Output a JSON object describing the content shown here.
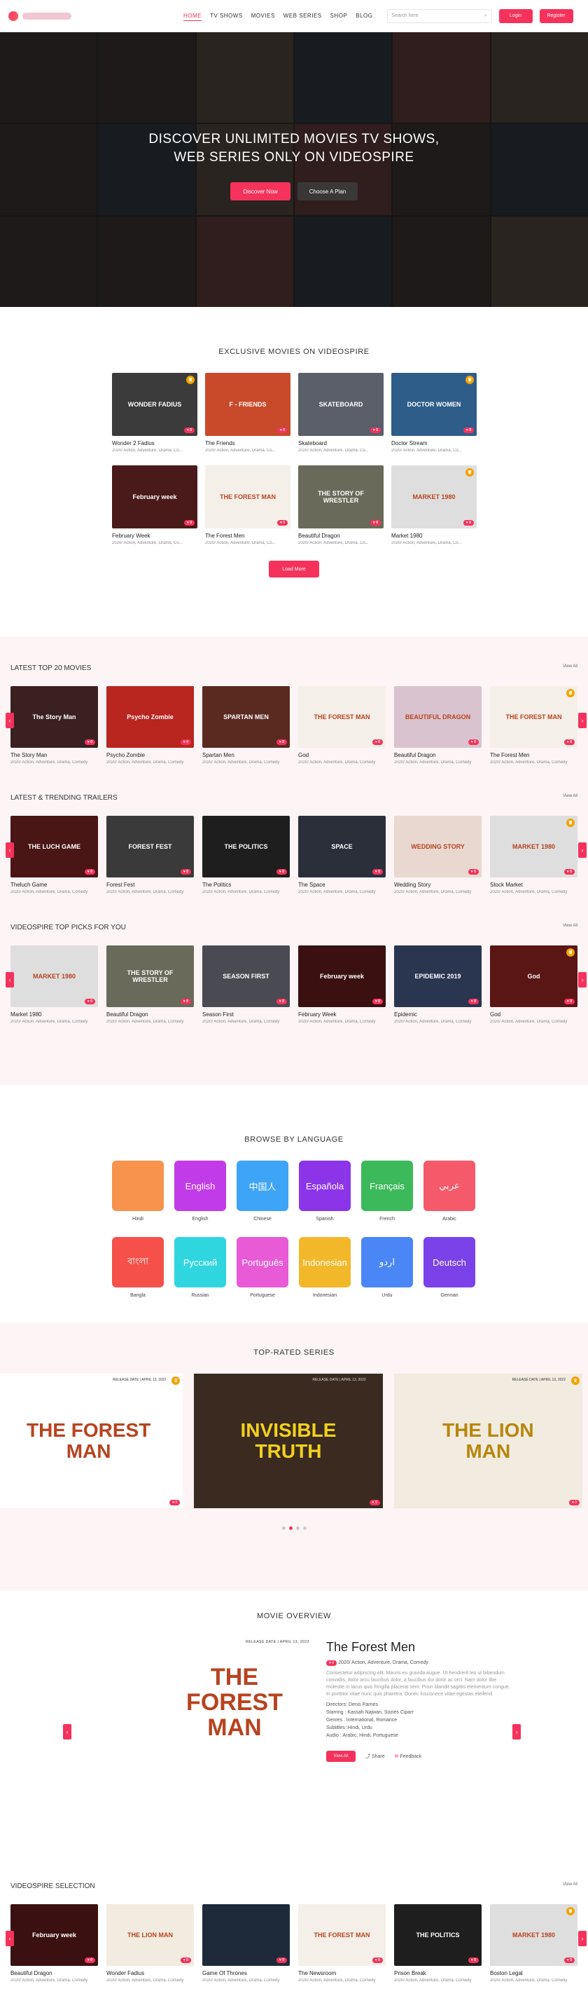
{
  "header": {
    "nav": [
      "HOME",
      "TV SHOWS",
      "MOVIES",
      "WEB SERIES",
      "SHOP",
      "BLOG"
    ],
    "search_placeholder": "Search here",
    "login": "Login",
    "register": "Register"
  },
  "hero": {
    "title_line1": "DISCOVER UNLIMITED MOVIES TV SHOWS,",
    "title_line2": "WEB SERIES ONLY ON VIDEOSPIRE",
    "btn_discover": "Discover Now",
    "btn_plan": "Choose A Plan"
  },
  "exclusive": {
    "title": "EXCLUSIVE MOVIES ON VIDEOSPIRE",
    "meta": "2020/ Action, Adventure, Drama, Co...",
    "load_more": "Load More",
    "items": [
      {
        "name": "Wonder 2 Fadius",
        "art": "WONDER FADIUS",
        "color": "#3b3b3b"
      },
      {
        "name": "The Friends",
        "art": "F - FRIENDS",
        "color": "#c94a2a"
      },
      {
        "name": "Skateboard",
        "art": "SKATEBOARD",
        "color": "#5a5f6a"
      },
      {
        "name": "Doctor Stream",
        "art": "DOCTOR WOMEN",
        "color": "#2f5d8a"
      },
      {
        "name": "February Week",
        "art": "February week",
        "color": "#4a1a1a"
      },
      {
        "name": "The Forest Men",
        "art": "THE FOREST MAN",
        "color": "#f4efe8"
      },
      {
        "name": "Beautiful Dragon",
        "art": "THE STORY OF WRESTLER",
        "color": "#6a6a5a"
      },
      {
        "name": "Market 1980",
        "art": "MARKET 1980",
        "color": "#dedede"
      }
    ]
  },
  "rows": [
    {
      "title": "LATEST TOP 20 MOVIES",
      "view_all": "View All",
      "meta": "2020/ Action, Adventure, Drama, Comedy",
      "items": [
        {
          "name": "The Story Man",
          "art": "The Story Man",
          "color": "#3a2020"
        },
        {
          "name": "Psycho Zombie",
          "art": "Psycho Zombie",
          "color": "#b8261f"
        },
        {
          "name": "Spartan Men",
          "art": "SPARTAN MEN",
          "color": "#5a2a20"
        },
        {
          "name": "God",
          "art": "THE FOREST MAN",
          "color": "#f4efe8"
        },
        {
          "name": "Beautiful Dragon",
          "art": "BEAUTIFUL DRAGON",
          "color": "#d9c3ce"
        },
        {
          "name": "The Forest Men",
          "art": "THE FOREST MAN",
          "color": "#f4efe8"
        }
      ]
    },
    {
      "title": "LATEST & TRENDING TRAILERS",
      "view_all": "View All",
      "meta": "2020/ Action, Adventure, Drama, Comedy",
      "items": [
        {
          "name": "Theluch Game",
          "art": "THE LUCH GAME",
          "color": "#4a1515"
        },
        {
          "name": "Forest Fest",
          "art": "FOREST FEST",
          "color": "#3a3a3a"
        },
        {
          "name": "The Politics",
          "art": "THE POLITICS",
          "color": "#1e1e1e"
        },
        {
          "name": "The Space",
          "art": "SPACE",
          "color": "#2a2f3a"
        },
        {
          "name": "Wedding Story",
          "art": "WEDDING STORY",
          "color": "#e8d8d0"
        },
        {
          "name": "Stock Market",
          "art": "MARKET 1980",
          "color": "#dedede"
        }
      ]
    },
    {
      "title": "VIDEOSPIRE TOP PICKS FOR YOU",
      "view_all": "View All",
      "meta": "2020/ Action, Adventure, Drama, Comedy",
      "items": [
        {
          "name": "Market 1980",
          "art": "MARKET 1980",
          "color": "#dedede"
        },
        {
          "name": "Beautiful Dragon",
          "art": "THE STORY OF WRESTLER",
          "color": "#6a6a5a"
        },
        {
          "name": "Season First",
          "art": "SEASON FIRST",
          "color": "#4a4a52"
        },
        {
          "name": "February Week",
          "art": "February week",
          "color": "#3a1010"
        },
        {
          "name": "Epidemic",
          "art": "EPIDEMIC 2019",
          "color": "#2a3550"
        },
        {
          "name": "God",
          "art": "God",
          "color": "#5a1515"
        }
      ]
    }
  ],
  "language": {
    "title": "BROWSE BY LANGUAGE",
    "items": [
      {
        "tile": "",
        "label": "Hindi",
        "color": "#f7934c"
      },
      {
        "tile": "English",
        "label": "English",
        "color": "#c23be8"
      },
      {
        "tile": "中国人",
        "label": "Chinese",
        "color": "#3ea4f5"
      },
      {
        "tile": "Española",
        "label": "Spanish",
        "color": "#8b34e8"
      },
      {
        "tile": "Français",
        "label": "French",
        "color": "#3cb95a"
      },
      {
        "tile": "عربي",
        "label": "Arabic",
        "color": "#f55a6b"
      },
      {
        "tile": "বাংলা",
        "label": "Bangla",
        "color": "#f5504a"
      },
      {
        "tile": "Русский",
        "label": "Russian",
        "color": "#2fd6e0"
      },
      {
        "tile": "Português",
        "label": "Portuguese",
        "color": "#e85ad6"
      },
      {
        "tile": "Indonesian",
        "label": "Indonesian",
        "color": "#f2b82a"
      },
      {
        "tile": "اردو",
        "label": "Urdu",
        "color": "#4a86f5"
      },
      {
        "tile": "Deutsch",
        "label": "German",
        "color": "#7a42e8"
      }
    ]
  },
  "series": {
    "title": "TOP-RATED SERIES",
    "release": "RELEASE DATE | APRIL 13, 2022",
    "cards": [
      {
        "art": "THE FOREST MAN",
        "fg": "#b8431f",
        "bg": "#ffffff"
      },
      {
        "art": "INVISIBLE TRUTH",
        "fg": "#f2d21b",
        "bg": "#3a2a20"
      },
      {
        "art": "THE LION MAN",
        "fg": "#b8860b",
        "bg": "#f1ebe0"
      }
    ]
  },
  "overview": {
    "title": "MOVIE OVERVIEW",
    "release": "RELEASE DATE | APRIL 13, 2022",
    "art": "THE FOREST MAN",
    "name": "The Forest Men",
    "meta": "2020/ Action, Adventure, Drama, Comedy",
    "desc": "Consectetur adipiscing elit. Mauris eu gravida augue. Ut hendrerit leo ut bibendum convallis, dolor arcu faucibus dolor, a faucibus dui dolor ac orci. Nam dolor libe molestie in lacus quis fringilla placerat sem. Proin blandit sagittis elementum congue. In porttitor vitae nunc quis pharetra. Donec fuscisnece vitae egestas eleifend.",
    "directors": "Directors: Denis Parnes",
    "starring": "Starring : Kassah Najwan, Sozies Ciparr",
    "genres": "Genres : International, Romance",
    "subtitles": "Subtitles :Hindi, Urdu",
    "audio": "Audio : Arabic, Hindi, Portuguese",
    "view_all": "View All",
    "share": "Share",
    "feedback": "Feedback"
  },
  "selection": {
    "title": "VIDEOSPIRE SELECTION",
    "view_all": "View All",
    "meta": "2020/ Action, Adventure, Drama, Comedy",
    "items": [
      {
        "name": "Beautiful Dragon",
        "art": "February week",
        "color": "#3a1010"
      },
      {
        "name": "Wonder Fadius",
        "art": "THE LION MAN",
        "color": "#f1ebe0"
      },
      {
        "name": "Game Of Thrones",
        "art": "",
        "color": "#1e2a3a"
      },
      {
        "name": "The Newsroom",
        "art": "THE FOREST MAN",
        "color": "#f4efe8"
      },
      {
        "name": "Prison Break",
        "art": "THE POLITICS",
        "color": "#1e1e1e"
      },
      {
        "name": "Boston Legal",
        "art": "MARKET 1980",
        "color": "#dedede"
      }
    ]
  }
}
